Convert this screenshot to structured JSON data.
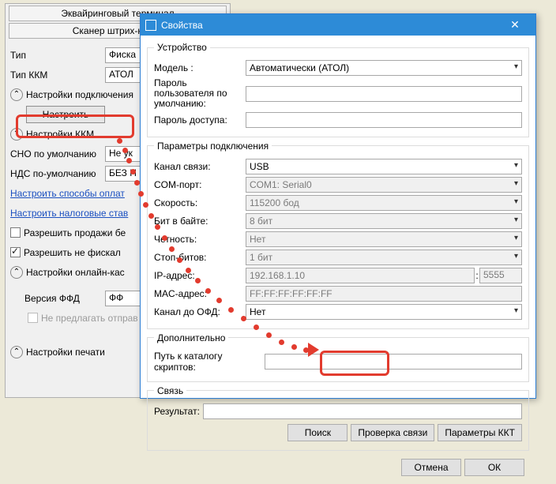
{
  "bg": {
    "header1": "Эквайринговый терминал",
    "header2": "Сканер штрих-кодов",
    "type_label": "Тип",
    "type_value": "Фиска",
    "kkm_type_label": "Тип ККМ",
    "kkm_type_value": "АТОЛ",
    "sec_conn": "Настройки подключения",
    "configure": "Настроить",
    "sec_kkm": "Настройки ККМ",
    "sno_label": "СНО по умолчанию",
    "sno_value": "Не ук",
    "nds_label": "НДС по-умолчанию",
    "nds_value": "БЕЗ Н",
    "link_pay": "Настроить способы оплат",
    "link_tax": "Настроить налоговые став",
    "chk_sales": "Разрешить продажи бе",
    "chk_fiscal": "Разрешить не фискал",
    "sec_online": "Настройки онлайн-кас",
    "ffd_label": "Версия ФФД",
    "ffd_value": "ФФ",
    "dont_offer": "Не предлагать отправ",
    "sec_print": "Настройки печати"
  },
  "dialog": {
    "title": "Свойства",
    "grp_device": "Устройство",
    "model_label": "Модель :",
    "model_value": "Автоматически (АТОЛ)",
    "userpass_label": "Пароль пользователя по умолчанию:",
    "accesspass_label": "Пароль доступа:",
    "grp_conn": "Параметры подключения",
    "channel_label": "Канал связи:",
    "channel_value": "USB",
    "comport_label": "COM-порт:",
    "comport_value": "COM1: Serial0",
    "speed_label": "Скорость:",
    "speed_value": "115200 бод",
    "bits_label": "Бит в байте:",
    "bits_value": "8 бит",
    "parity_label": "Четность:",
    "parity_value": "Нет",
    "stopbits_label": "Стоп-битов:",
    "stopbits_value": "1 бит",
    "ip_label": "IP-адрес:",
    "ip_value": "192.168.1.10",
    "port_value": "5555",
    "mac_label": "MAC-адрес:",
    "mac_value": "FF:FF:FF:FF:FF:FF",
    "ofd_label": "Канал до ОФД:",
    "ofd_value": "Нет",
    "grp_extra": "Дополнительно",
    "scriptpath_label": "Путь к каталогу скриптов:",
    "grp_link": "Связь",
    "result_label": "Результат:",
    "btn_search": "Поиск",
    "btn_check": "Проверка связи",
    "btn_params": "Параметры ККТ",
    "btn_cancel": "Отмена",
    "btn_ok": "ОК"
  }
}
